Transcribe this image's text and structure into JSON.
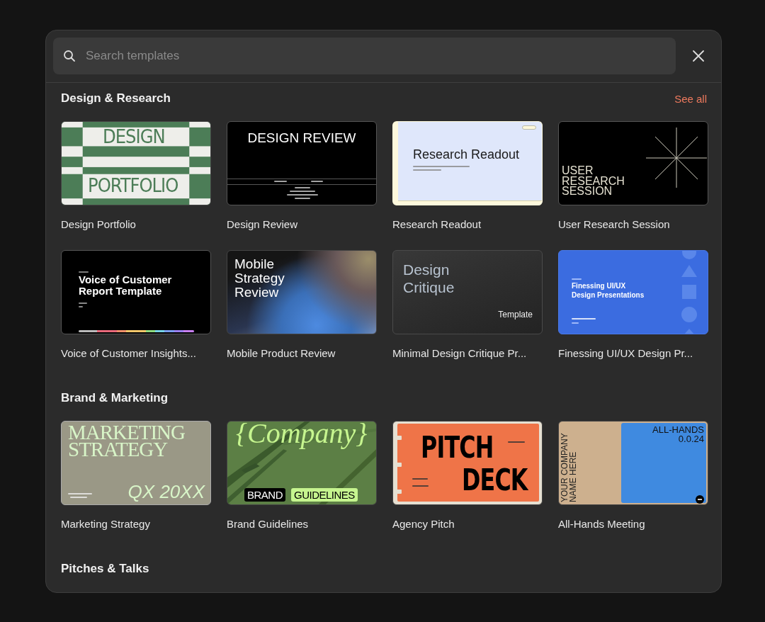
{
  "search": {
    "placeholder": "Search templates"
  },
  "sections": [
    {
      "title": "Design & Research",
      "see_all": "See all",
      "templates": [
        {
          "name": "Design Portfolio",
          "thumb": {
            "kind": "portfolio",
            "texts": [
              "DESIGN",
              "PORTFOLIO"
            ]
          }
        },
        {
          "name": "Design Review",
          "thumb": {
            "kind": "review",
            "texts": [
              "DESIGN REVIEW"
            ]
          }
        },
        {
          "name": "Research Readout",
          "thumb": {
            "kind": "readout",
            "texts": [
              "Research Readout"
            ]
          }
        },
        {
          "name": "User Research Session",
          "thumb": {
            "kind": "session",
            "texts": [
              "USER",
              "RESEARCH",
              "SESSION"
            ]
          }
        },
        {
          "name": "Voice of Customer Insights...",
          "thumb": {
            "kind": "voice",
            "texts": [
              "Voice of Customer",
              "Report Template"
            ]
          }
        },
        {
          "name": "Mobile Product Review",
          "thumb": {
            "kind": "mobile",
            "texts": [
              "Mobile",
              "Strategy",
              "Review"
            ]
          }
        },
        {
          "name": "Minimal Design Critique Pr...",
          "thumb": {
            "kind": "critique",
            "texts": [
              "Design",
              "Critique",
              "Template"
            ]
          }
        },
        {
          "name": "Finessing UI/UX Design Pr...",
          "thumb": {
            "kind": "finessing",
            "texts": [
              "Finessing UI/UX",
              "Design Presentations"
            ]
          }
        }
      ]
    },
    {
      "title": "Brand & Marketing",
      "templates": [
        {
          "name": "Marketing Strategy",
          "thumb": {
            "kind": "marketing",
            "texts": [
              "MARKETING",
              "STRATEGY",
              "QX 20XX"
            ]
          }
        },
        {
          "name": "Brand Guidelines",
          "thumb": {
            "kind": "brand",
            "texts": [
              "{Company}",
              "BRAND",
              "GUIDELINES"
            ]
          }
        },
        {
          "name": "Agency Pitch",
          "thumb": {
            "kind": "pitch",
            "texts": [
              "PITCH",
              "DECK"
            ]
          }
        },
        {
          "name": "All-Hands Meeting",
          "thumb": {
            "kind": "allhands",
            "texts": [
              "YOUR COMPANY",
              "NAME HERE",
              "ALL-HANDS",
              "0.0.24"
            ]
          }
        }
      ]
    },
    {
      "title": "Pitches & Talks"
    }
  ]
}
